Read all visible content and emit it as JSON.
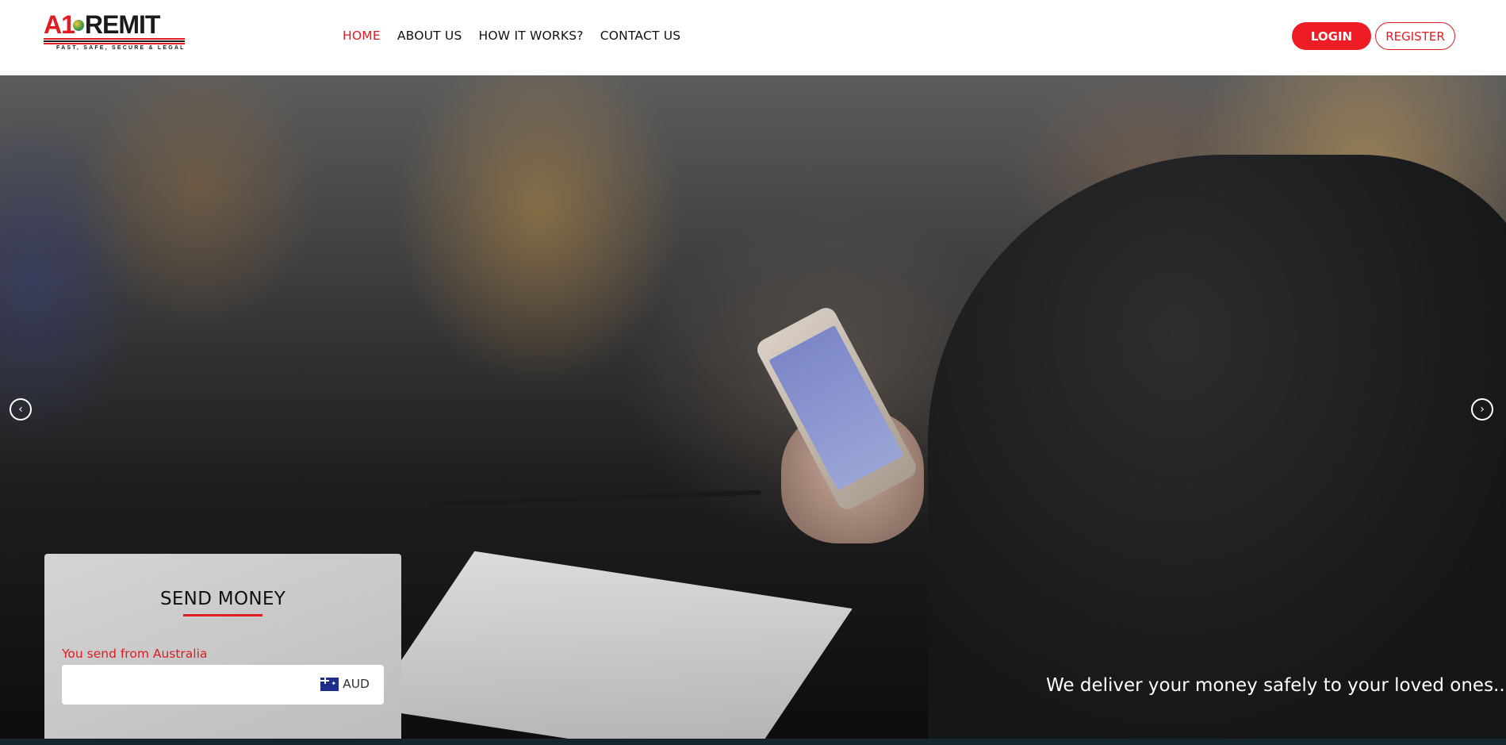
{
  "brand": {
    "logo_a1": "A1",
    "logo_remit": "REMIT",
    "tagline": "FAST, SAFE, SECURE & LEGAL"
  },
  "nav": {
    "items": [
      {
        "label": "HOME",
        "active": true
      },
      {
        "label": "ABOUT US",
        "active": false
      },
      {
        "label": "HOW IT WORKS?",
        "active": false
      },
      {
        "label": "CONTACT US",
        "active": false
      }
    ]
  },
  "auth": {
    "login_label": "LOGIN",
    "register_label": "REGISTER"
  },
  "hero": {
    "prev_icon": "‹",
    "next_icon": "›",
    "caption": "We deliver your money safely to your loved ones.."
  },
  "send_money": {
    "title": "SEND MONEY",
    "from_label": "You send from Australia",
    "amount_value": "",
    "currency_code": "AUD",
    "flag_icon": "australia-flag-icon"
  },
  "colors": {
    "accent": "#e01b22",
    "login_bg": "#ee1c25"
  }
}
